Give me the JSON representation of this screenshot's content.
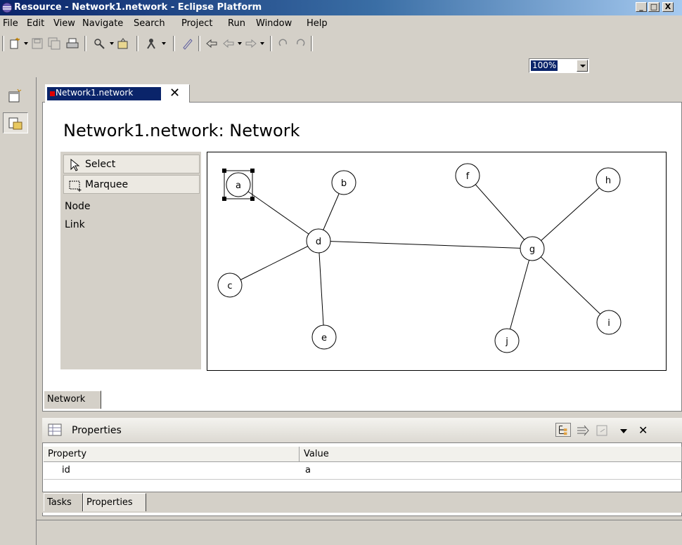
{
  "window": {
    "title": "Resource - Network1.network - Eclipse Platform",
    "buttons": [
      "_",
      "□",
      "X"
    ]
  },
  "menu": [
    "File",
    "Edit",
    "View",
    "Navigate",
    "Search",
    "Project",
    "Run",
    "Window",
    "Help"
  ],
  "toolbar": {
    "zoom": "100%",
    "icons": [
      "new-wizard-icon",
      "save-icon",
      "save-all-icon",
      "print-icon",
      "search-icon",
      "open-type-icon",
      "run-icon",
      "annotation-icon",
      "last-edit-icon",
      "back-icon",
      "forward-icon",
      "undo-icon",
      "redo-icon"
    ]
  },
  "editor": {
    "tab_label": "Network1.network",
    "tab_close": "✕",
    "diagram_title": "Network1.network: Network",
    "page_tab": "Network"
  },
  "palette": {
    "tools": [
      {
        "label": "Select",
        "icon": "arrow-pointer-icon"
      },
      {
        "label": "Marquee",
        "icon": "marquee-icon"
      }
    ],
    "entries": [
      "Node",
      "Link"
    ]
  },
  "network": {
    "nodes": [
      {
        "id": "a",
        "selected": true
      },
      {
        "id": "b"
      },
      {
        "id": "c"
      },
      {
        "id": "d"
      },
      {
        "id": "e"
      },
      {
        "id": "f"
      },
      {
        "id": "g"
      },
      {
        "id": "h"
      },
      {
        "id": "i"
      },
      {
        "id": "j"
      }
    ],
    "links": [
      [
        "a",
        "d"
      ],
      [
        "b",
        "d"
      ],
      [
        "c",
        "d"
      ],
      [
        "e",
        "d"
      ],
      [
        "d",
        "g"
      ],
      [
        "f",
        "g"
      ],
      [
        "h",
        "g"
      ],
      [
        "i",
        "g"
      ],
      [
        "j",
        "g"
      ]
    ]
  },
  "properties": {
    "title": "Properties",
    "columns": [
      "Property",
      "Value"
    ],
    "rows": [
      {
        "property": "id",
        "value": "a"
      }
    ],
    "close": "✕"
  },
  "bottom_tabs": [
    "Tasks",
    "Properties"
  ]
}
